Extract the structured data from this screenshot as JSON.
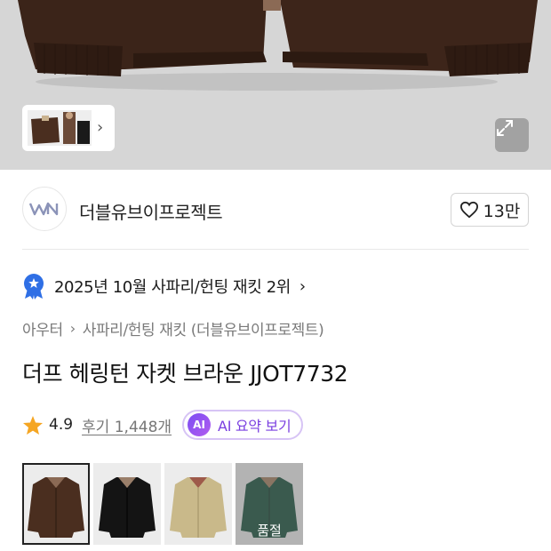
{
  "brand": {
    "name": "더블유브이프로젝트",
    "logo_icon": "wv-logo-icon"
  },
  "likes": {
    "count": "13만",
    "icon": "heart-outline-icon"
  },
  "ranking": {
    "text": "2025년 10월 사파리/헌팅 재킷 2위",
    "icon": "ranking-badge-icon"
  },
  "breadcrumb": {
    "items": [
      "아우터",
      "사파리/헌팅 재킷 (더블유브이프로젝트)"
    ]
  },
  "product": {
    "title": "더프 헤링턴 자켓 브라운 JJOT7732"
  },
  "rating": {
    "score": "4.9",
    "reviews": "후기 1,448개"
  },
  "ai_summary": {
    "badge": "AI",
    "label": "AI 요약 보기"
  },
  "colors": {
    "accent_purple": "#7a3fe0",
    "star": "#f5a623",
    "rank_badge": "#2f6fe5"
  },
  "options": [
    {
      "name": "brown",
      "swatch": "#4a2e1f",
      "selected": true,
      "sold_out": false
    },
    {
      "name": "black",
      "swatch": "#141414",
      "selected": false,
      "sold_out": false
    },
    {
      "name": "beige",
      "swatch": "#c9b98a",
      "selected": false,
      "sold_out": false
    },
    {
      "name": "green",
      "swatch": "#0f4a34",
      "selected": false,
      "sold_out": true,
      "sold_out_label": "품절"
    }
  ]
}
